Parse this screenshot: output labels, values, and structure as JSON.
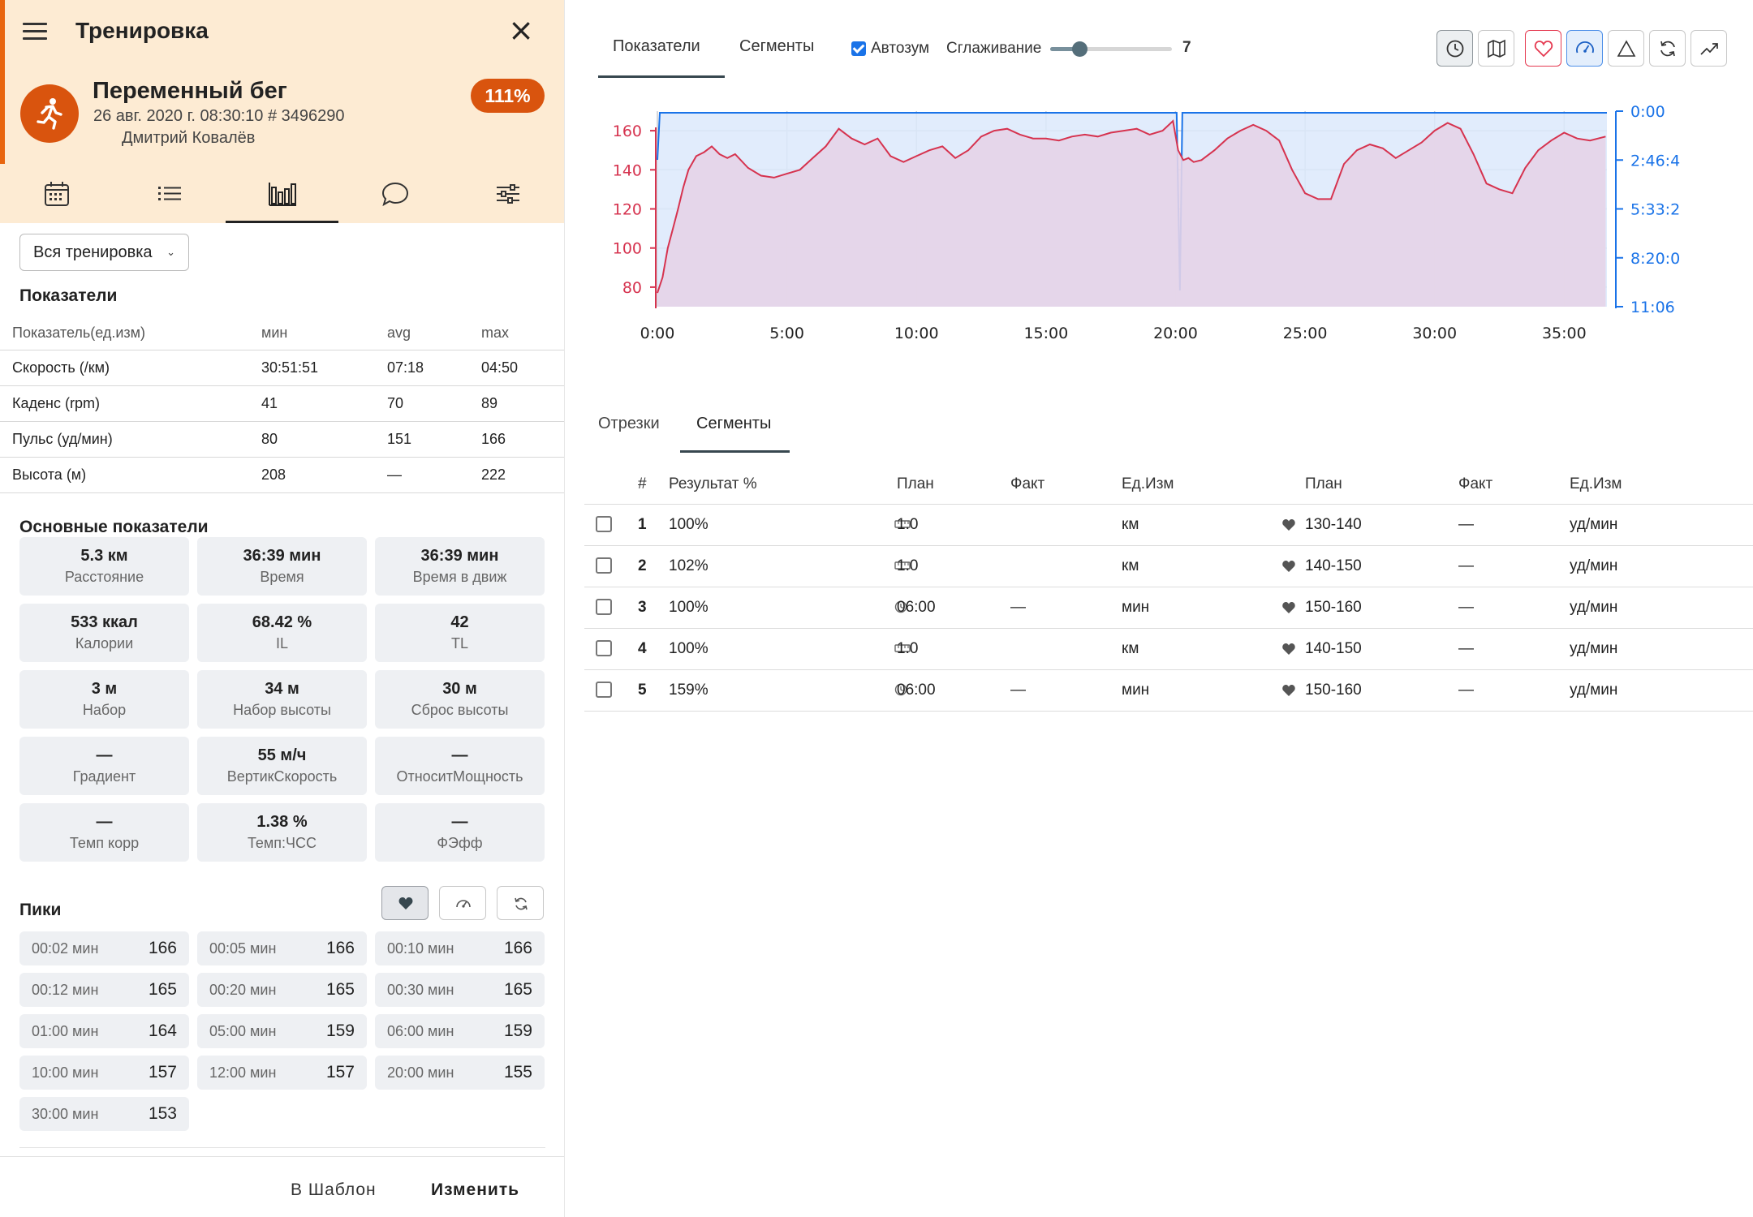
{
  "header": {
    "title": "Тренировка",
    "workout_name": "Переменный бег",
    "meta": "26 авг. 2020 г. 08:30:10 # 3496290",
    "athlete": "Дмитрий Ковалёв",
    "compliance": "111%",
    "accent_color": "#d9540e",
    "header_bg": "#fdebd3"
  },
  "left_tabs": [
    {
      "icon": "calendar-icon"
    },
    {
      "icon": "list-icon"
    },
    {
      "icon": "bar-chart-icon",
      "active": true
    },
    {
      "icon": "comment-icon"
    },
    {
      "icon": "sliders-icon"
    }
  ],
  "scope_select": {
    "value": "Вся тренировка"
  },
  "metrics_section": {
    "title": "Показатели",
    "headers": [
      "Показатель(ед.изм)",
      "мин",
      "avg",
      "max"
    ],
    "rows": [
      [
        "Скорость (/км)",
        "30:51:51",
        "07:18",
        "04:50"
      ],
      [
        "Каденс (rpm)",
        "41",
        "70",
        "89"
      ],
      [
        "Пульс (уд/мин)",
        "80",
        "151",
        "166"
      ],
      [
        "Высота (м)",
        "208",
        "—",
        "222"
      ]
    ]
  },
  "kpi_section": {
    "title": "Основные показатели",
    "items": [
      {
        "value": "5.3 км",
        "label": "Расстояние"
      },
      {
        "value": "36:39 мин",
        "label": "Время"
      },
      {
        "value": "36:39 мин",
        "label": "Время в движ"
      },
      {
        "value": "533 ккал",
        "label": "Калории"
      },
      {
        "value": "68.42 %",
        "label": "IL"
      },
      {
        "value": "42",
        "label": "TL"
      },
      {
        "value": "3 м",
        "label": "Набор"
      },
      {
        "value": "34 м",
        "label": "Набор высоты"
      },
      {
        "value": "30 м",
        "label": "Сброс высоты"
      },
      {
        "value": "—",
        "label": "Градиент"
      },
      {
        "value": "55 м/ч",
        "label": "ВертикСкорость"
      },
      {
        "value": "—",
        "label": "ОтноситМощность"
      },
      {
        "value": "—",
        "label": "Темп корр"
      },
      {
        "value": "1.38 %",
        "label": "Темп:ЧСС"
      },
      {
        "value": "—",
        "label": "ФЭфф"
      }
    ]
  },
  "peaks_section": {
    "title": "Пики",
    "buttons": [
      "heart-icon",
      "speedometer-icon",
      "refresh-icon"
    ],
    "items": [
      {
        "duration": "00:02 мин",
        "value": "166"
      },
      {
        "duration": "00:05 мин",
        "value": "166"
      },
      {
        "duration": "00:10 мин",
        "value": "166"
      },
      {
        "duration": "00:12 мин",
        "value": "165"
      },
      {
        "duration": "00:20 мин",
        "value": "165"
      },
      {
        "duration": "00:30 мин",
        "value": "165"
      },
      {
        "duration": "01:00 мин",
        "value": "164"
      },
      {
        "duration": "05:00 мин",
        "value": "159"
      },
      {
        "duration": "06:00 мин",
        "value": "159"
      },
      {
        "duration": "10:00 мин",
        "value": "157"
      },
      {
        "duration": "12:00 мин",
        "value": "157"
      },
      {
        "duration": "20:00 мин",
        "value": "155"
      },
      {
        "duration": "30:00 мин",
        "value": "153"
      }
    ]
  },
  "footer": {
    "template_button": "В Шаблон",
    "edit_button": "Изменить"
  },
  "right_tabs": {
    "metrics": "Показатели",
    "segments": "Сегменты"
  },
  "controls": {
    "autozoom_label": "Автозум",
    "autozoom_checked": true,
    "smoothing_label": "Сглаживание",
    "smoothing_value": "7"
  },
  "toolbar": [
    "clock-icon",
    "map-icon",
    "heart-icon",
    "speedometer-icon",
    "triangle-icon",
    "refresh-icon",
    "trend-icon"
  ],
  "chart_data": {
    "type": "area",
    "x_ticks": [
      "0:00",
      "5:00",
      "10:00",
      "15:00",
      "20:00",
      "25:00",
      "30:00",
      "35:00"
    ],
    "x_range_minutes": [
      0,
      36.65
    ],
    "y_left": {
      "ticks": [
        "80",
        "100",
        "120",
        "140",
        "160"
      ],
      "range": [
        70,
        170
      ],
      "color": "#d6334f"
    },
    "y_right": {
      "ticks": [
        "0:00",
        "2:46:4",
        "5:33:2",
        "8:20:0",
        "11:06"
      ],
      "color": "#1a73e8"
    },
    "grid": true,
    "series": [
      {
        "color": "#d6334f",
        "fill": "#e5d4e8",
        "x": [
          0,
          0.2,
          0.4,
          0.6,
          0.8,
          1.0,
          1.2,
          1.5,
          1.8,
          2.1,
          2.4,
          2.7,
          3.0,
          3.5,
          4.0,
          4.5,
          5.0,
          5.5,
          6.0,
          6.5,
          7.0,
          7.5,
          8.0,
          8.5,
          9.0,
          9.5,
          10.0,
          10.5,
          11.0,
          11.5,
          12.0,
          12.5,
          13.0,
          13.5,
          14.0,
          14.5,
          15.0,
          15.5,
          16.0,
          16.5,
          17.0,
          17.5,
          18.0,
          18.5,
          19.0,
          19.5,
          19.9,
          20.1,
          20.3,
          20.5,
          20.7,
          21.0,
          21.5,
          22.0,
          22.5,
          23.0,
          23.5,
          24.0,
          24.5,
          25.0,
          25.5,
          26.0,
          26.5,
          27.0,
          27.5,
          28.0,
          28.5,
          29.0,
          29.5,
          30.0,
          30.5,
          31.0,
          31.5,
          32.0,
          32.5,
          33.0,
          33.5,
          34.0,
          34.5,
          35.0,
          35.5,
          36.0,
          36.6
        ],
        "values": [
          77,
          85,
          100,
          110,
          120,
          131,
          140,
          147,
          149,
          152,
          148,
          146,
          148,
          141,
          137,
          136,
          138,
          140,
          146,
          152,
          161,
          156,
          153,
          156,
          147,
          144,
          147,
          150,
          152,
          146,
          150,
          157,
          160,
          161,
          158,
          156,
          156,
          155,
          157,
          158,
          157,
          159,
          160,
          161,
          158,
          160,
          165,
          150,
          145,
          146,
          144,
          145,
          150,
          156,
          160,
          163,
          160,
          155,
          140,
          128,
          125,
          125,
          143,
          150,
          153,
          151,
          146,
          150,
          154,
          160,
          164,
          161,
          148,
          133,
          130,
          128,
          141,
          150,
          155,
          159,
          156,
          155,
          157
        ]
      },
      {
        "color": "#1a73e8",
        "fill": "#dce9fb",
        "dip_minutes": 20.2
      }
    ]
  },
  "segments": {
    "tabs": [
      "Отрезки",
      "Сегменты"
    ],
    "active_tab": "Сегменты",
    "headers": [
      "#",
      "Результат %",
      "План",
      "Факт",
      "Ед.Изм",
      "План",
      "Факт",
      "Ед.Изм"
    ],
    "rows": [
      {
        "n": "1",
        "result": "100%",
        "type_icon": "ruler-icon",
        "plan": "1.0",
        "fact": "",
        "unit": "км",
        "hr_plan": "130-140",
        "hr_fact": "—",
        "hr_unit": "уд/мин"
      },
      {
        "n": "2",
        "result": "102%",
        "type_icon": "ruler-icon",
        "plan": "1.0",
        "fact": "",
        "unit": "км",
        "hr_plan": "140-150",
        "hr_fact": "—",
        "hr_unit": "уд/мин"
      },
      {
        "n": "3",
        "result": "100%",
        "type_icon": "clock-icon",
        "plan": "06:00",
        "fact": "—",
        "unit": "мин",
        "hr_plan": "150-160",
        "hr_fact": "—",
        "hr_unit": "уд/мин"
      },
      {
        "n": "4",
        "result": "100%",
        "type_icon": "ruler-icon",
        "plan": "1.0",
        "fact": "",
        "unit": "км",
        "hr_plan": "140-150",
        "hr_fact": "—",
        "hr_unit": "уд/мин"
      },
      {
        "n": "5",
        "result": "159%",
        "type_icon": "clock-icon",
        "plan": "06:00",
        "fact": "—",
        "unit": "мин",
        "hr_plan": "150-160",
        "hr_fact": "—",
        "hr_unit": "уд/мин"
      }
    ]
  }
}
